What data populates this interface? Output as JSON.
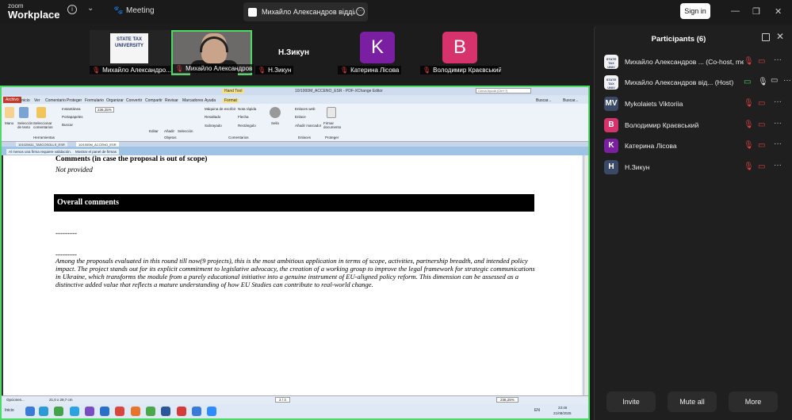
{
  "app": {
    "logo_line1": "zoom",
    "logo_line2": "Workplace",
    "meeting_label": "Meeting",
    "tab_title": "Михайло Александров відділ мі",
    "signin_label": "Sign in",
    "win_min": "—",
    "win_restore": "❐",
    "win_close": "✕"
  },
  "tiles": [
    {
      "name": "Михайло Александро...",
      "logo_text": "STATE TAX UNIVERSITY"
    },
    {
      "name": "Михайло Александров ві..."
    },
    {
      "name": "Н.Зикун",
      "big_name": "Н.Зикун"
    },
    {
      "name": "Катерина Лісова",
      "initial": "K",
      "color": "#7b1fa2"
    },
    {
      "name": "Володимир Краєвський",
      "initial": "B",
      "color": "#d6336c"
    }
  ],
  "pdf": {
    "window_title": "10/1000M_ACCENO_ESR - PDF-XChange Editor",
    "hand_tool": "Hand Tool",
    "search_placeholder": "Cerca Ayuda (Ctrl+?)",
    "ribbon_tabs": [
      "Archivo",
      "Inicio",
      "Ver",
      "Comentario",
      "Proteger",
      "Formulario",
      "Organizar",
      "Convertir",
      "Compartir",
      "Revisar",
      "Marcadores",
      "Ayuda",
      "Format"
    ],
    "ribbon_labels": {
      "mano": "Mano",
      "seleccion_texto": "Selección de texto",
      "seleccionar_comentarios": "Seleccionar comentarios",
      "instantanea": "Instantánea",
      "portapapeles": "Portapapeles",
      "buscar": "Buscar",
      "herramientas": "Herramientas",
      "zoom_value": "236,25%",
      "editar": "Editar",
      "anadir": "Añadir",
      "seleccion": "Selección",
      "objetos": "Objetos",
      "maquina_escribir": "Máquina de escribir",
      "nota_rapida": "Nota rápida",
      "resaltado": "Resaltado",
      "flecha": "Flecha",
      "subrayado": "Subrayado",
      "rectangulo": "Rectángulo",
      "comentarios_group": "Comentarios",
      "sello": "Sello",
      "enlaces_web": "Enlaces web",
      "enlace": "Enlace",
      "anadir_marcador": "Añadir marcador",
      "enlaces_group": "Enlaces",
      "firmar_documento": "Firmar documento",
      "proteger_group": "Proteger",
      "buscar_right": "Buscar...",
      "buscar_right2": "Buscar..."
    },
    "doc_tabs": [
      "101020611_TASCOSOLLS_ESR",
      "10/1000M_ACCENO_ESR"
    ],
    "notices": [
      "Al menos una firma requiere validación.",
      "Mostrar el panel de firmas"
    ],
    "content": {
      "comments_heading": "Comments (in case the proposal is out of scope)",
      "not_provided": "Not provided",
      "overall_heading": "Overall comments",
      "dash1": "---------",
      "dash2": "---------",
      "paragraph": "Among the proposals evaluated in this round till now(9 projects), this is the most ambitious application in terms of scope, activities, partnership breadth, and intended policy impact. The project stands out for its explicit commitment to legislative advocacy, the creation of a working group to improve the legal framework for strategic communications in Ukraine, which transforms the module from a purely educational initiative into a genuine instrument of EU-aligned policy reform. This dimension can be assessed as a distinctive added value that reflects a mature understanding of how EU Studies can contribute to real-world change."
    },
    "status": {
      "options": "Opciones...",
      "size": "21,0 x 29,7 cm",
      "page": "2 / 3",
      "zoom": "236,25%"
    },
    "taskbar": {
      "start": "Inicio",
      "lang": "EN",
      "time": "23:46",
      "date": "21/08/2025"
    }
  },
  "panel": {
    "title": "Participants (6)",
    "participants": [
      {
        "name": "Михайло Александров ...  (Co-host, me)",
        "avatar": "",
        "logo": true,
        "mic": "muted",
        "cam": "off"
      },
      {
        "name": "Михайло Александров від... (Host)",
        "avatar": "",
        "logo": true,
        "mic": "on",
        "cam": "on"
      },
      {
        "name": "Mykolaiets Viktoriia",
        "avatar": "MV",
        "color": "#3a4a66",
        "mic": "muted",
        "cam": "off"
      },
      {
        "name": "Володимир Краєвський",
        "avatar": "B",
        "color": "#d6336c",
        "mic": "muted",
        "cam": "off"
      },
      {
        "name": "Катерина Лісова",
        "avatar": "K",
        "color": "#7b1fa2",
        "mic": "muted",
        "cam": "off"
      },
      {
        "name": "Н.Зикун",
        "avatar": "H",
        "color": "#3a4a66",
        "mic": "muted",
        "cam": "off"
      }
    ],
    "buttons": {
      "invite": "Invite",
      "mute_all": "Mute all",
      "more": "More"
    }
  },
  "colors": {
    "active_border": "#4cd964",
    "muted": "#e04040",
    "panel_bg": "#1f1f1f"
  }
}
